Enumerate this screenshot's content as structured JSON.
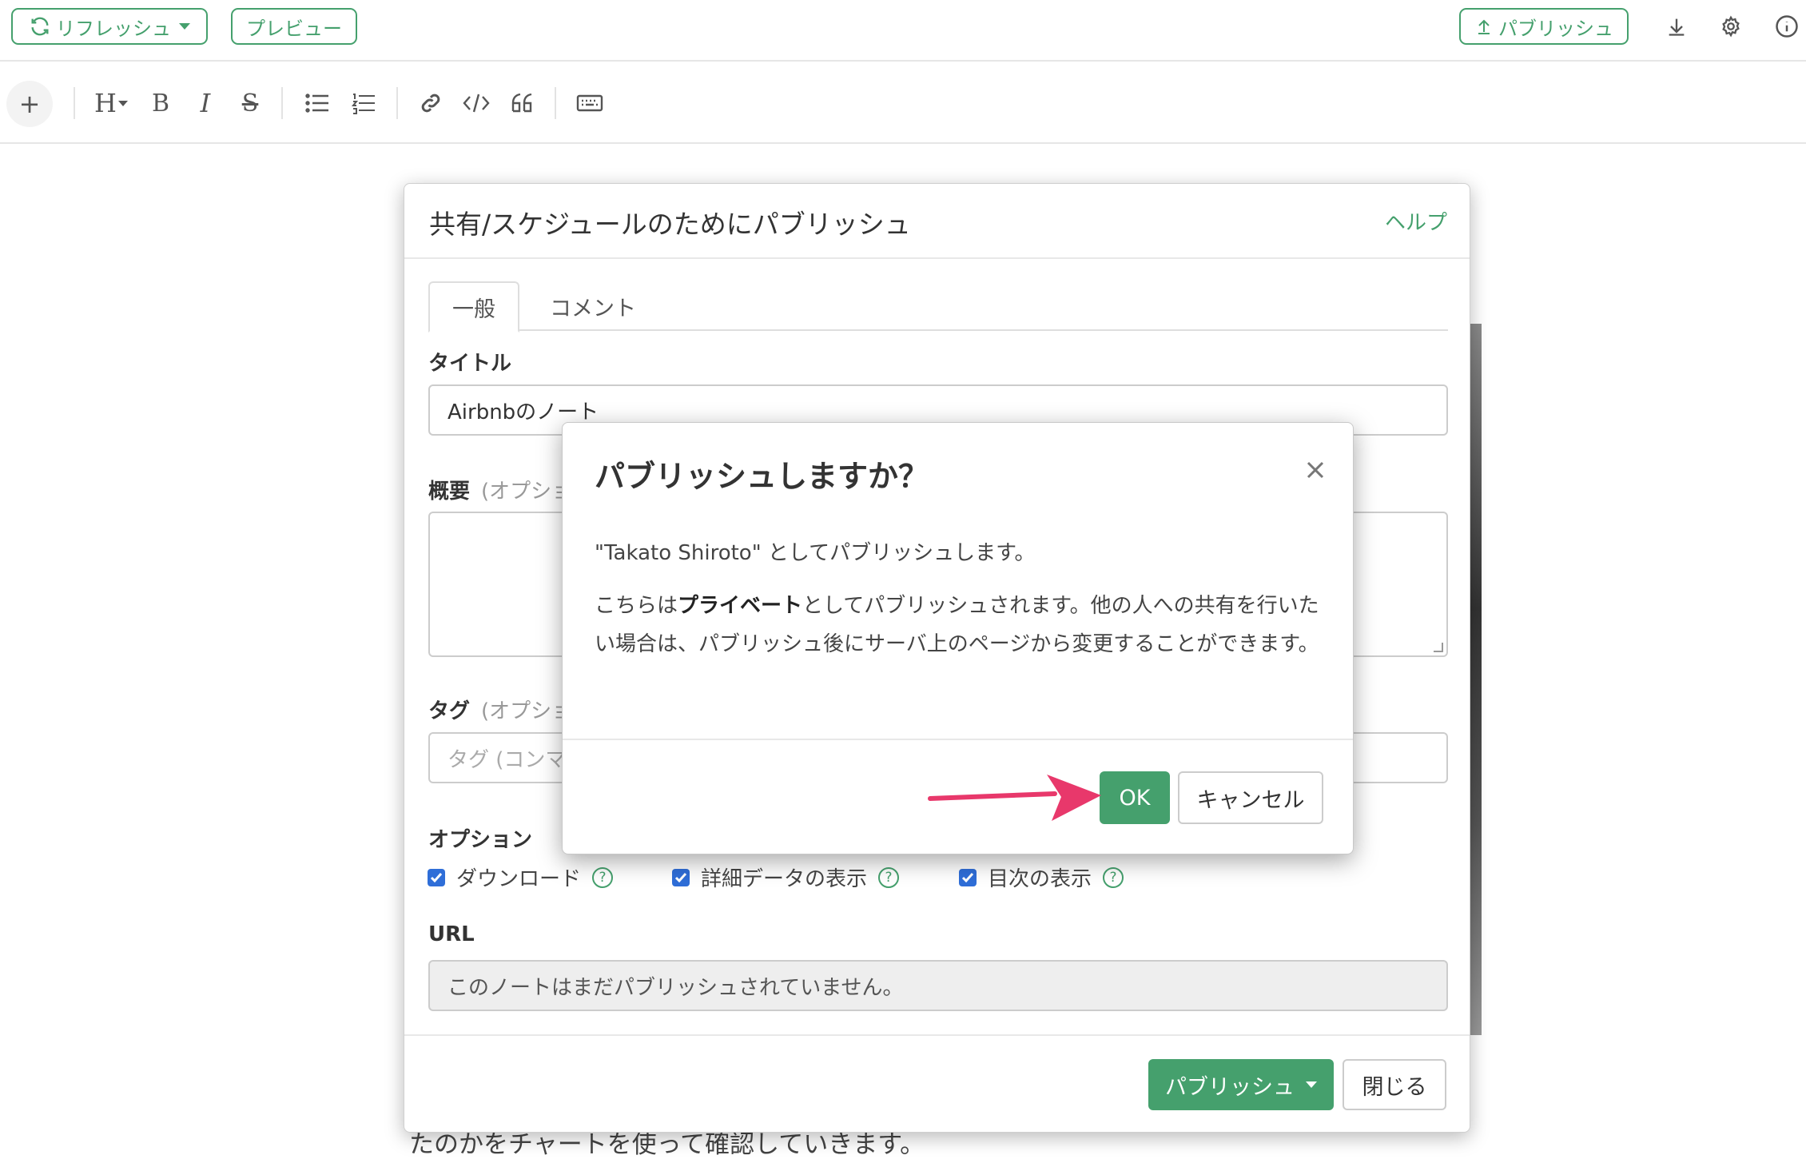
{
  "topbar": {
    "refresh_label": "リフレッシュ",
    "preview_label": "プレビュー",
    "publish_label": "パブリッシュ"
  },
  "icons": {
    "refresh": "refresh-icon",
    "upload": "upload-icon",
    "download": "download-icon",
    "settings": "gear-icon",
    "info": "info-icon"
  },
  "toolbar": {
    "plus": "+",
    "heading": "H",
    "bold": "B",
    "italic": "I",
    "strike": "S"
  },
  "background": {
    "visible_text": "たのかをチャートを使って確認していきます。"
  },
  "publish_modal": {
    "title": "共有/スケジュールのためにパブリッシュ",
    "help": "ヘルプ",
    "tabs": [
      "一般",
      "コメント"
    ],
    "title_label": "タイトル",
    "title_value": "Airbnbのノート",
    "summary_label": "概要",
    "summary_optional": "(オプショ",
    "tag_label": "タグ",
    "tag_optional": "(オプショ",
    "tag_placeholder": "タグ (コンマ",
    "options_label": "オプション",
    "options": [
      {
        "label": "ダウンロード",
        "checked": true
      },
      {
        "label": "詳細データの表示",
        "checked": true
      },
      {
        "label": "目次の表示",
        "checked": true
      }
    ],
    "url_label": "URL",
    "url_value": "このノートはまだパブリッシュされていません。",
    "publish_button": "パブリッシュ",
    "close_button": "閉じる",
    "help_mark": "?"
  },
  "confirm_dialog": {
    "title": "パブリッシュしますか？",
    "line1": "\"Takato Shiroto\" としてパブリッシュします。",
    "para_prefix": "こちらは",
    "para_bold": "プライベート",
    "para_rest": "としてパブリッシュされます。他の人への共有を行いたい場合は、パブリッシュ後にサーバ上のページから変更することができます。",
    "ok": "OK",
    "cancel": "キャンセル"
  },
  "colors": {
    "accent_green": "#45a06d",
    "checkbox_blue": "#2f6ed8",
    "arrow_pink": "#e8386b"
  }
}
